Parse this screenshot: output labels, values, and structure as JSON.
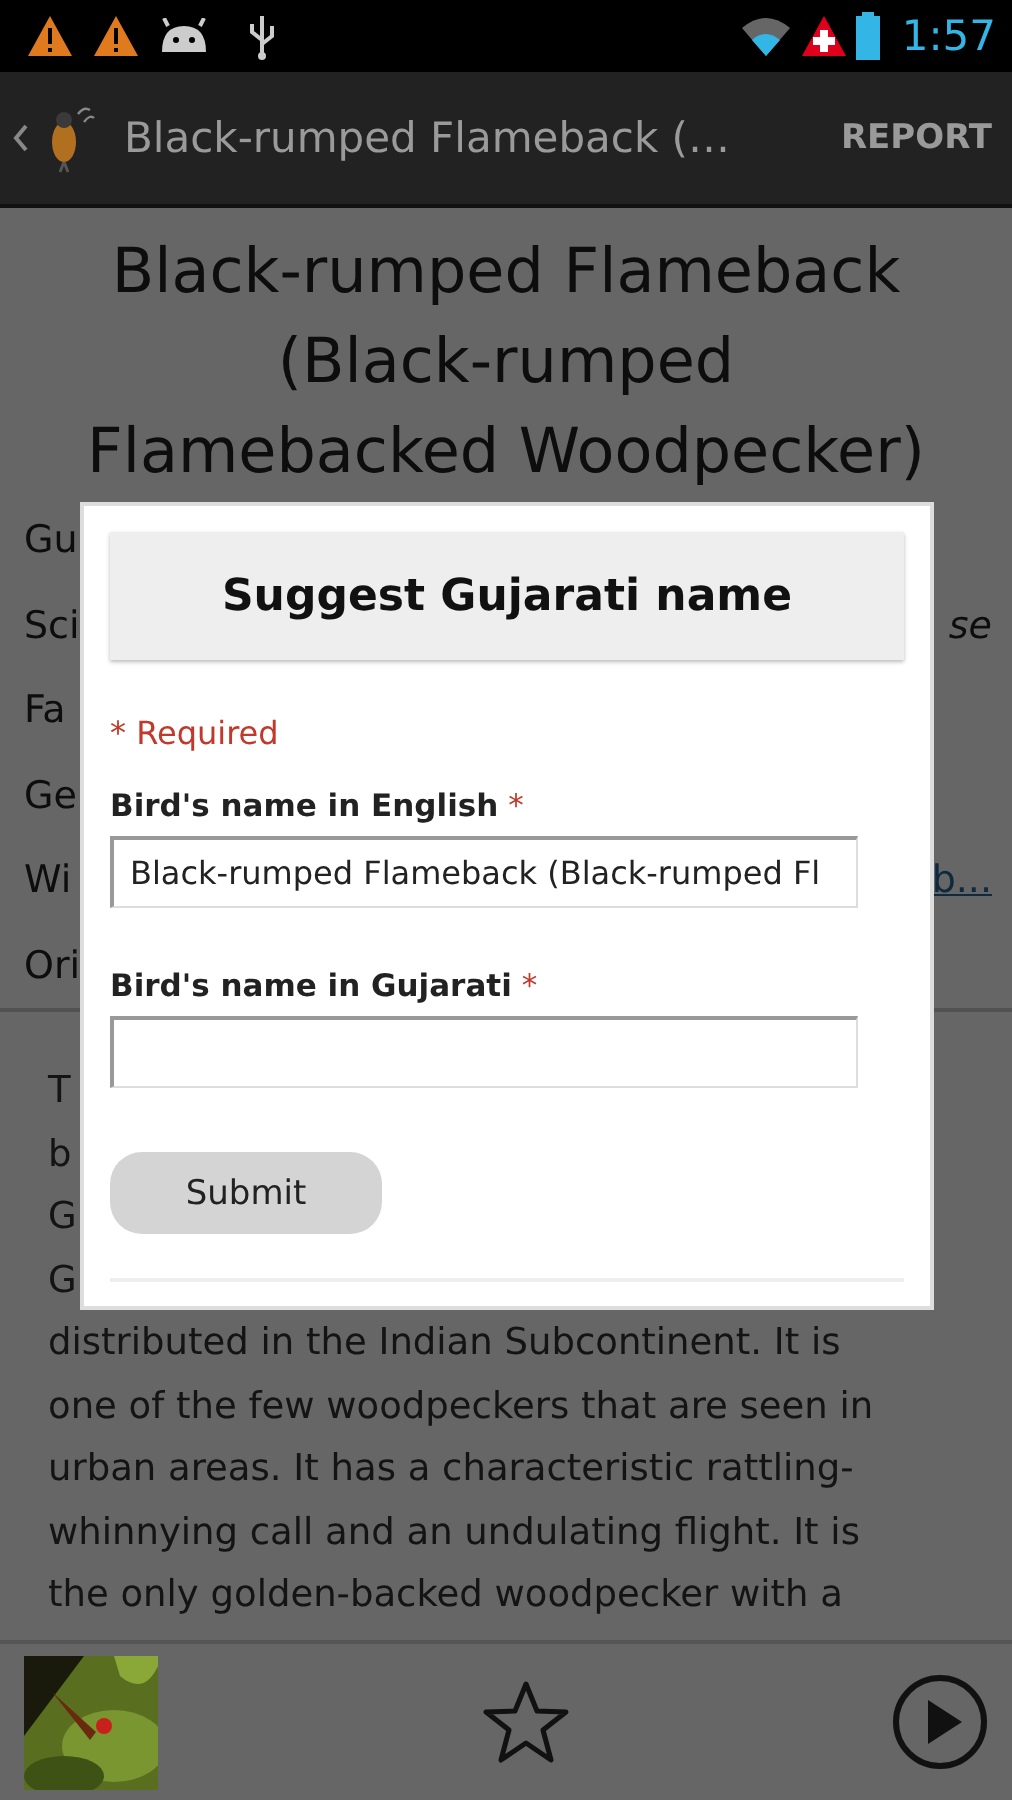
{
  "status_bar": {
    "time": "1:57"
  },
  "action_bar": {
    "title": "Black-rumped Flameback (…",
    "action": "REPORT"
  },
  "page": {
    "title_lines": [
      "Black-rumped Flameback",
      "(Black-rumped",
      "Flamebacked Woodpecker)"
    ],
    "info_rows": [
      {
        "label": "Gu"
      },
      {
        "label": "Sci",
        "value": "se",
        "kind": "italic"
      },
      {
        "label": "Fa"
      },
      {
        "label": "Ge"
      },
      {
        "label": "Wi",
        "value": "b...",
        "kind": "link"
      },
      {
        "label": "Ori"
      }
    ],
    "description_lines": [
      "T",
      "b",
      "G",
      "G",
      "distributed in the Indian Subcontinent. It is",
      "one of the few woodpeckers that are seen in",
      "urban areas. It has a characteristic rattling-",
      "whinnying call and an undulating flight. It is",
      "the only golden-backed woodpecker with a"
    ]
  },
  "dialog": {
    "title": "Suggest Gujarati name",
    "required_note": "* Required",
    "fields": [
      {
        "label": "Bird's name in English",
        "mark": "*",
        "value": "Black-rumped Flameback (Black-rumped Fl"
      },
      {
        "label": "Bird's name in Gujarati",
        "mark": "*"
      }
    ],
    "submit": "Submit"
  }
}
